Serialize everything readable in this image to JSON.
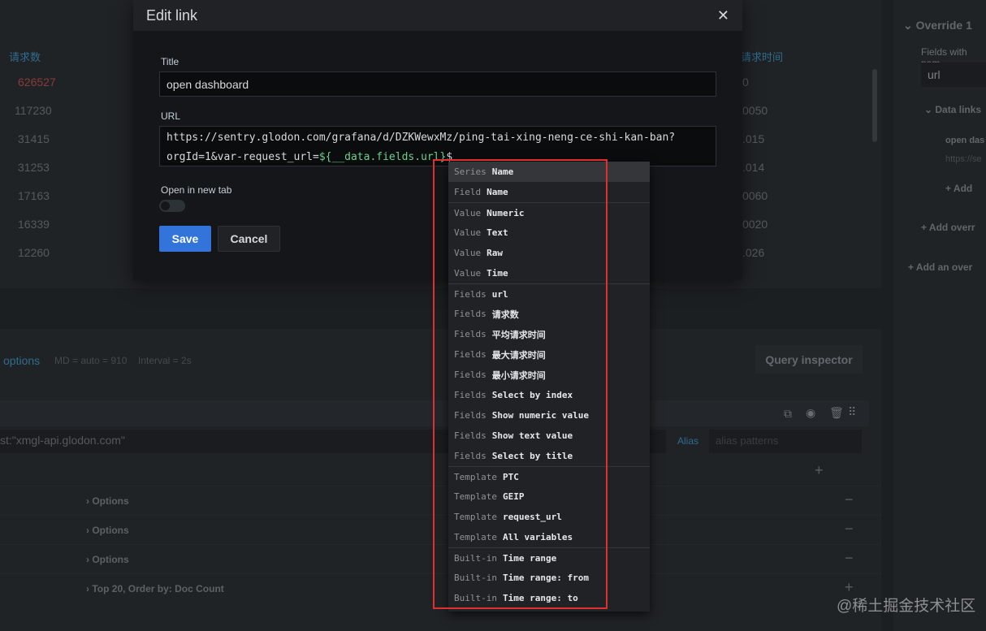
{
  "background_table": {
    "col1_header": "请求数",
    "col2_header": "请求时间",
    "col1_values": [
      "626527",
      "117230",
      "31415",
      "31253",
      "17163",
      "16339",
      "12260"
    ],
    "col2_values": [
      "0",
      "0050",
      ".015",
      ".014",
      "0060",
      "0020",
      ".026"
    ],
    "highlight_color": "#8a3b3b"
  },
  "override": {
    "title": "Override 1",
    "fields_label": "Fields with nam",
    "field_value": "url",
    "data_links": "Data links",
    "link_title": "open das",
    "link_url": "https://se",
    "add_link": "Add",
    "add_override_property": "Add overr",
    "add_override": "Add an over"
  },
  "query": {
    "options_link": "options",
    "md": "MD = auto = 910",
    "interval": "Interval = 2s",
    "inspector": "Query inspector",
    "query_text": "st:\"xmgl-api.glodon.com\"",
    "alias_label": "Alias",
    "alias_placeholder": "alias patterns",
    "rows": [
      "Options",
      "Options",
      "Options",
      "Top 20, Order by: Doc Count"
    ]
  },
  "modal": {
    "title": "Edit link",
    "title_label": "Title",
    "title_value": "open dashboard",
    "url_label": "URL",
    "url_line1": "https://sentry.glodon.com/grafana/d/DZKWewxMz/ping-tai-xing-neng-ce-shi-kan-ban?",
    "url_line2_prefix": "orgId=1&var-request_url=",
    "url_line2_var": "${__data.fields.url}",
    "url_line2_suffix": "$",
    "new_tab_label": "Open in new tab",
    "new_tab_on": false,
    "save": "Save",
    "cancel": "Cancel",
    "accent": "#3274d9"
  },
  "suggestions": [
    {
      "k": "Series",
      "v": "Name",
      "group": 0
    },
    {
      "k": "Field",
      "v": "Name",
      "group": 0
    },
    {
      "k": "Value",
      "v": "Numeric",
      "group": 1
    },
    {
      "k": "Value",
      "v": "Text",
      "group": 1
    },
    {
      "k": "Value",
      "v": "Raw",
      "group": 1
    },
    {
      "k": "Value",
      "v": "Time",
      "group": 1
    },
    {
      "k": "Fields",
      "v": "url",
      "group": 2
    },
    {
      "k": "Fields",
      "v": "请求数",
      "group": 2
    },
    {
      "k": "Fields",
      "v": "平均请求时间",
      "group": 2
    },
    {
      "k": "Fields",
      "v": "最大请求时间",
      "group": 2
    },
    {
      "k": "Fields",
      "v": "最小请求时间",
      "group": 2
    },
    {
      "k": "Fields",
      "v": "Select by index",
      "group": 2
    },
    {
      "k": "Fields",
      "v": "Show numeric value",
      "group": 2
    },
    {
      "k": "Fields",
      "v": "Show text value",
      "group": 2
    },
    {
      "k": "Fields",
      "v": "Select by title",
      "group": 2
    },
    {
      "k": "Template",
      "v": "PTC",
      "group": 3
    },
    {
      "k": "Template",
      "v": "GEIP",
      "group": 3
    },
    {
      "k": "Template",
      "v": "request_url",
      "group": 3
    },
    {
      "k": "Template",
      "v": "All variables",
      "group": 3
    },
    {
      "k": "Built-in",
      "v": "Time range",
      "group": 4
    },
    {
      "k": "Built-in",
      "v": "Time range: from",
      "group": 4
    },
    {
      "k": "Built-in",
      "v": "Time range: to",
      "group": 4
    }
  ],
  "watermark": "@稀土掘金技术社区"
}
